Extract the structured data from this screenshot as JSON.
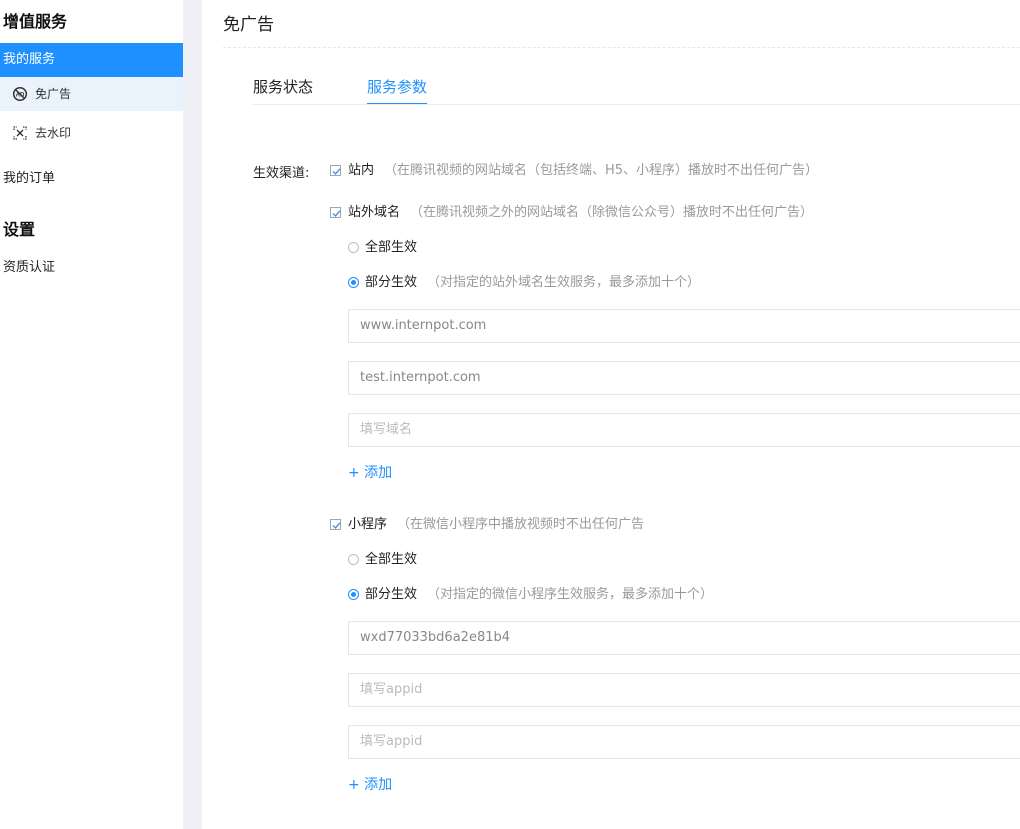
{
  "sidebar": {
    "section_title": "增值服务",
    "items": {
      "my_services": "我的服务",
      "ad_free": "免广告",
      "watermark": "去水印",
      "my_orders": "我的订单"
    },
    "settings_title": "设置",
    "certification": "资质认证"
  },
  "page": {
    "title": "免广告",
    "tabs": [
      "服务状态",
      "服务参数"
    ],
    "active_tab": "服务参数"
  },
  "form": {
    "channel_label": "生效渠道:",
    "onsite": {
      "label": "站内",
      "hint": "（在腾讯视频的网站域名（包括终端、H5、小程序）播放时不出任何广告）",
      "checked": true
    },
    "offsite": {
      "label": "站外域名",
      "hint": "（在腾讯视频之外的网站域名（除微信公众号）播放时不出任何广告）",
      "checked": true,
      "radio_all": "全部生效",
      "radio_partial": "部分生效",
      "partial_hint": "（对指定的站外域名生效服务，最多添加十个）",
      "selected": "partial",
      "domains": [
        "www.internpot.com",
        "test.internpot.com"
      ],
      "domain_placeholder": "填写域名",
      "add_label": "+ 添加"
    },
    "miniprogram": {
      "label": "小程序",
      "hint": "（在微信小程序中播放视频时不出任何广告",
      "checked": true,
      "radio_all": "全部生效",
      "radio_partial": "部分生效",
      "partial_hint": "（对指定的微信小程序生效服务，最多添加十个）",
      "selected": "partial",
      "appids": [
        "wxd77033bd6a2e81b4"
      ],
      "appid_placeholder": "填写appid",
      "add_label": "+ 添加"
    }
  },
  "colors": {
    "accent": "#1e90ff",
    "divider": "#eef0f6",
    "hint": "#9a9a9a"
  }
}
